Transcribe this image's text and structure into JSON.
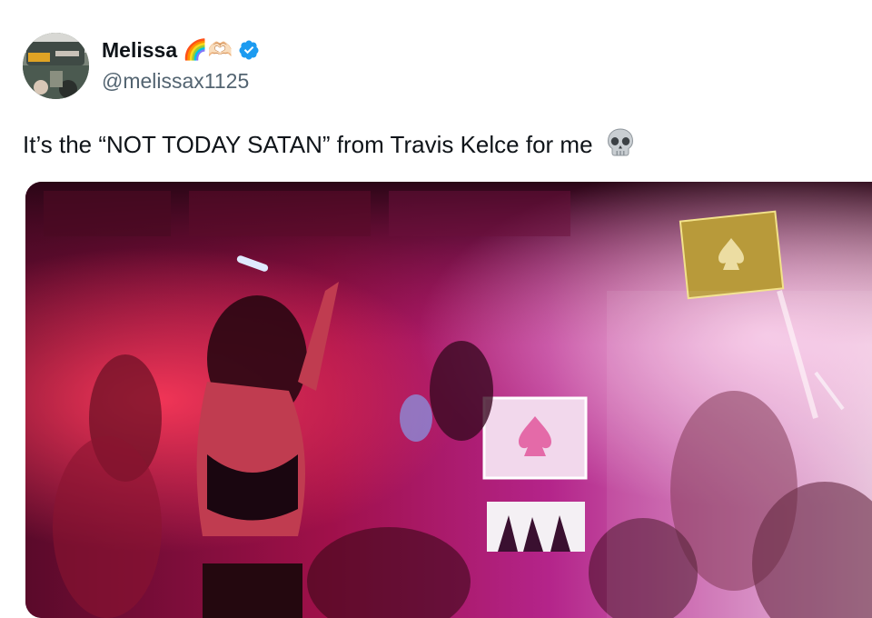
{
  "tweet": {
    "author": {
      "display_name": "Melissa",
      "name_emojis": "🌈🫶🏻",
      "handle": "@melissax1125",
      "verified": true,
      "avatar_icon": "avatar-photo"
    },
    "text": "It’s the “NOT TODAY SATAN” from Travis Kelce for me",
    "text_emoji_icon": "skull-icon",
    "media": {
      "type": "photo",
      "description_icon": "nightclub-photo"
    }
  },
  "colors": {
    "verified_blue": "#1d9bf0",
    "handle_gray": "#536471",
    "text": "#0f1419"
  }
}
